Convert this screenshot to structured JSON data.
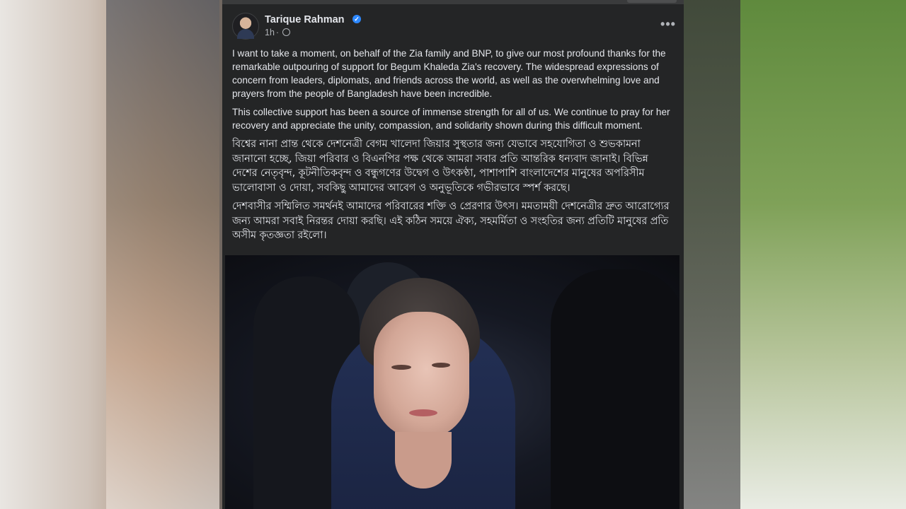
{
  "post": {
    "author": "Tarique Rahman",
    "verified": true,
    "time": "1h",
    "privacy_icon": "globe-icon",
    "more_icon": "more-horizontal-icon",
    "more_label": "•••",
    "paragraphs": [
      "I want to take a moment, on behalf of the Zia family and BNP, to give our most profound thanks for the remarkable outpouring of support for Begum Khaleda Zia's recovery. The widespread expressions of concern from leaders, diplomats, and friends across the world, as well as the overwhelming love and prayers from the people of Bangladesh have been incredible.",
      "This collective support has been a source of immense strength for all of us. We continue to pray for her recovery and appreciate the unity, compassion, and solidarity shown during this difficult moment.",
      "বিশ্বের নানা প্রান্ত থেকে দেশনেত্রী বেগম খালেদা জিয়ার সুস্থতার জন্য যেভাবে সহযোগিতা ও শুভকামনা জানানো হচ্ছে, জিয়া পরিবার ও বিএনপির পক্ষ থেকে আমরা সবার প্রতি আন্তরিক ধন্যবাদ জানাই। বিভিন্ন দেশের নেতৃবৃন্দ, কূটনীতিকবৃন্দ ও বন্ধুগণের উদ্বেগ ও উৎকণ্ঠা, পাশাপাশি বাংলাদেশের মানুষের অপরিসীম ভালোবাসা ও দোয়া, সবকিছু আমাদের আবেগ ও অনুভূতিকে গভীরভাবে স্পর্শ করছে।",
      "দেশবাসীর সম্মিলিত সমর্থনই আমাদের পরিবারের শক্তি ও প্রেরণার উৎস। মমতাময়ী দেশনেত্রীর দ্রুত আরোগ্যের জন্য আমরা সবাই নিরন্তর দোয়া করছি। এই কঠিন সময়ে ঐক্য, সহমর্মিতা ও সংহতির জন্য প্রতিটি মানুষের প্রতি অসীম কৃতজ্ঞতা রইলো।"
    ]
  },
  "colors": {
    "card_bg": "#242526",
    "text": "#e4e6eb",
    "secondary_text": "#b0b3b8",
    "verified_badge": "#2d88ff"
  }
}
